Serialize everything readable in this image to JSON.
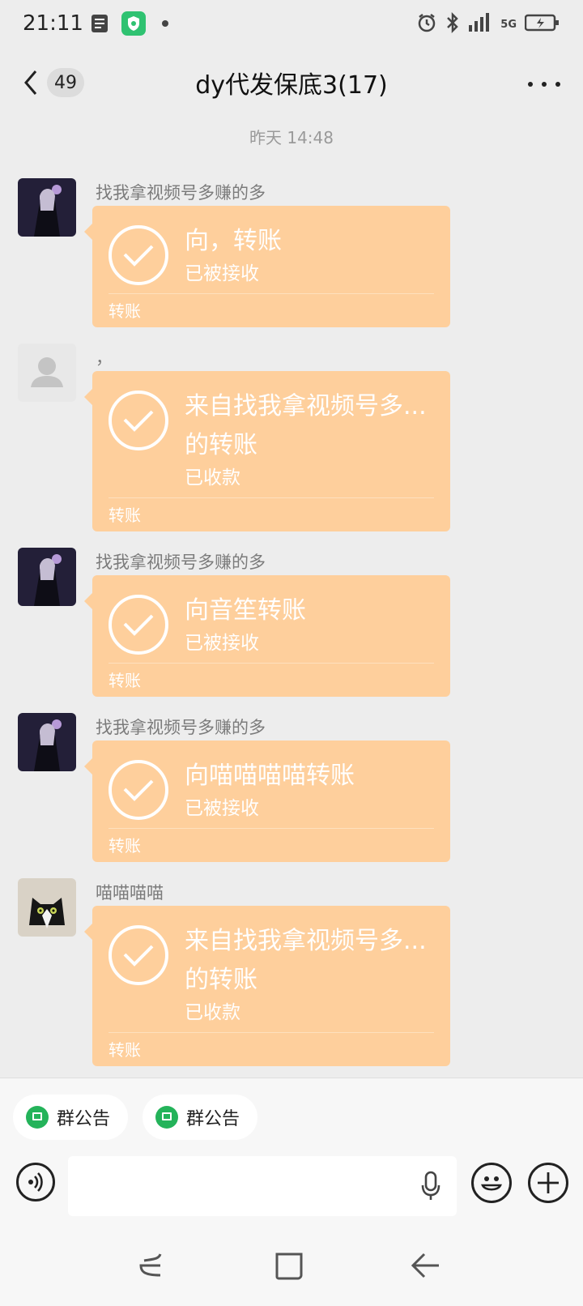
{
  "status_bar": {
    "time": "21:11",
    "icons": [
      "document-notification-icon",
      "shield-security-icon",
      "dot-icon",
      "alarm-icon",
      "bluetooth-icon",
      "signal-icon",
      "5g-icon",
      "battery-charging-icon"
    ],
    "network": "5G"
  },
  "header": {
    "unread_count": "49",
    "title": "dy代发保底3(17)"
  },
  "chat": {
    "timestamp": "昨天 14:48",
    "messages": [
      {
        "sender": "找我拿视频号多赚的多",
        "avatar": "dark-character-avatar",
        "card_title": "向，转账",
        "card_status": "已被接收",
        "card_footer": "转账"
      },
      {
        "sender": "，",
        "avatar": "default-user-avatar",
        "card_title": "来自找我拿视频号多...的转账",
        "card_status": "已收款",
        "card_footer": "转账"
      },
      {
        "sender": "找我拿视频号多赚的多",
        "avatar": "dark-character-avatar",
        "card_title": "向音笙转账",
        "card_status": "已被接收",
        "card_footer": "转账"
      },
      {
        "sender": "找我拿视频号多赚的多",
        "avatar": "dark-character-avatar",
        "card_title": "向喵喵喵喵转账",
        "card_status": "已被接收",
        "card_footer": "转账"
      },
      {
        "sender": "喵喵喵喵",
        "avatar": "cat-avatar",
        "card_title": "来自找我拿视频号多...的转账",
        "card_status": "已收款",
        "card_footer": "转账"
      }
    ]
  },
  "bottom": {
    "quick_actions": [
      "群公告",
      "群公告"
    ]
  },
  "system_nav": [
    "recent-apps-icon",
    "home-icon",
    "back-icon"
  ],
  "colors": {
    "transfer_card": "#fecf9c",
    "background": "#ededed",
    "notice_green": "#24b35a"
  }
}
